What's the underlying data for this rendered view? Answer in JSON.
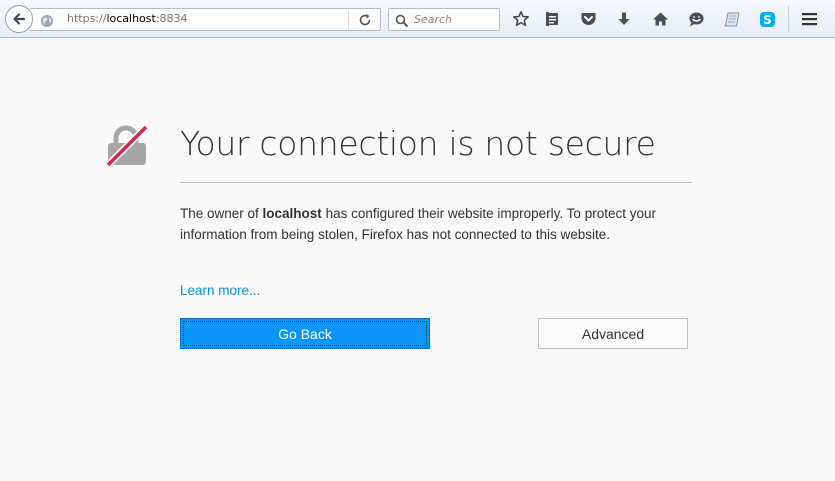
{
  "toolbar": {
    "url": {
      "scheme": "https://",
      "host": "localhost",
      "port": ":8834"
    },
    "search_placeholder": "Search",
    "icons": [
      "back-icon",
      "globe-icon",
      "reload-icon",
      "search-icon",
      "bookmark-star-icon",
      "reading-list-icon",
      "pocket-icon",
      "download-icon",
      "home-icon",
      "chat-icon",
      "notepad-icon",
      "skype-icon",
      "menu-icon"
    ]
  },
  "error_page": {
    "title": "Your connection is not secure",
    "description": {
      "part1": "The owner of ",
      "host": "localhost",
      "part2": " has configured their website improperly. To protect your information from being stolen, Firefox has not connected to this website."
    },
    "learn_more": "Learn more...",
    "go_back_label": "Go Back",
    "advanced_label": "Advanced"
  },
  "colors": {
    "primary_button": "#0996f8",
    "link": "#0096dd",
    "lock_slash": "#d7264c"
  }
}
